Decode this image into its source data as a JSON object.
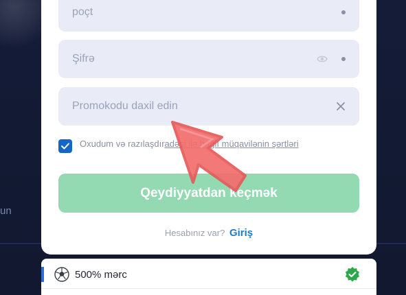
{
  "background": {
    "partial_text": "un"
  },
  "form": {
    "email_placeholder": "poçt",
    "password_placeholder": "Şifrə",
    "promo_placeholder": "Promokodu daxil edin",
    "consent_checked": true,
    "consent_text_start": "Oxudum və razılaşdır",
    "consent_text_link": "adəsi ilə bağlı müqavilənin şərtləri",
    "submit_label": "Qeydiyyatdan keçmək",
    "have_account": "Hesabınız var?",
    "login_link": "Giriş"
  },
  "bonus": {
    "label": "500% mərc",
    "selected": true
  },
  "colors": {
    "accent_blue": "#1666c8",
    "submit_green": "#93d9b2",
    "badge_green": "#2aa84a",
    "cursor_red": "#f26d6d"
  },
  "icons": [
    "eye-icon",
    "close-icon",
    "checkmark-icon",
    "soccer-ball-icon",
    "verified-badge-icon",
    "pointer-cursor-icon"
  ]
}
